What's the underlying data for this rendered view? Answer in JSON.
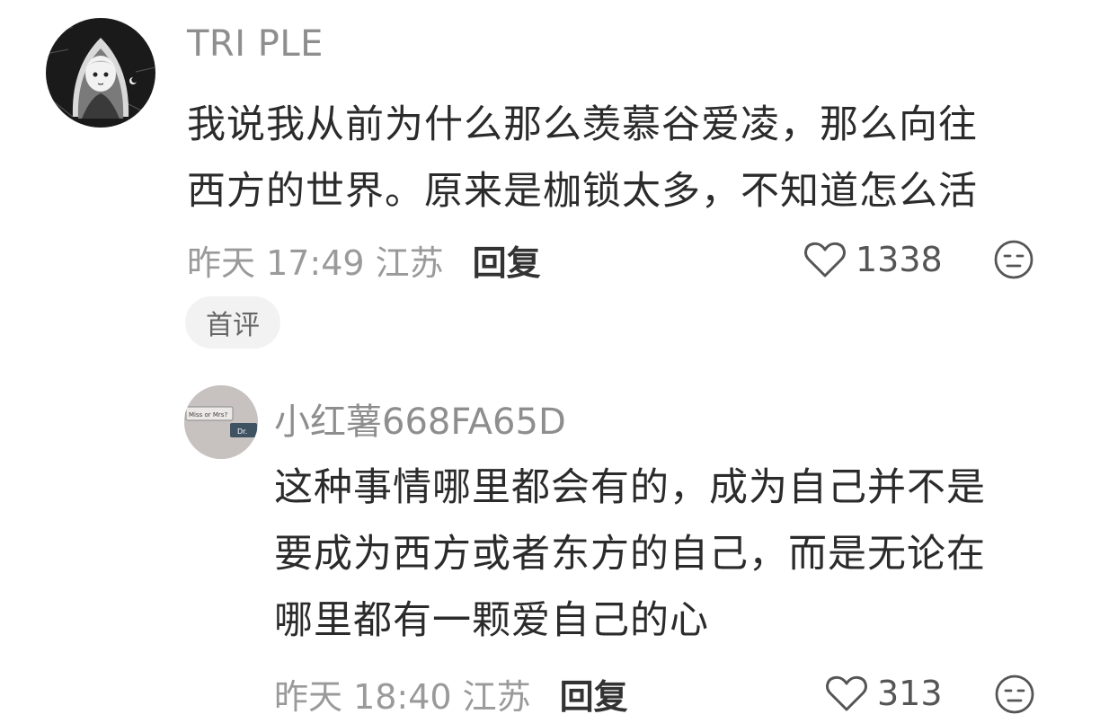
{
  "comments": [
    {
      "username": "TRI PLE",
      "avatar": "illustrated-hooded-girl-avatar",
      "text_lines": [
        "我说我从前为什么那么羡慕谷爱凌，那么向往",
        "西方的世界。原来是枷锁太多，不知道怎么活"
      ],
      "time_location": "昨天 17:49 江苏",
      "reply_label": "回复",
      "likes": "1338",
      "badge": "首评"
    },
    {
      "username": "小红薯668FA65D",
      "avatar": "miss-or-mrs-dr-avatar",
      "avatar_text": [
        "Miss or Mrs?",
        "Dr."
      ],
      "text_lines": [
        "这种事情哪里都会有的，成为自己并不是",
        "要成为西方或者东方的自己，而是无论在",
        "哪里都有一颗爱自己的心"
      ],
      "time_location": "昨天 18:40 江苏",
      "reply_label": "回复",
      "likes": "313"
    }
  ],
  "icons": {
    "like": "heart-outline-icon",
    "dislike": "unhappy-face-icon"
  },
  "colors": {
    "username": "#8e8e8e",
    "body": "#2b2b2b",
    "meta": "#9a9a9a",
    "badge_bg": "#f2f2f2"
  }
}
